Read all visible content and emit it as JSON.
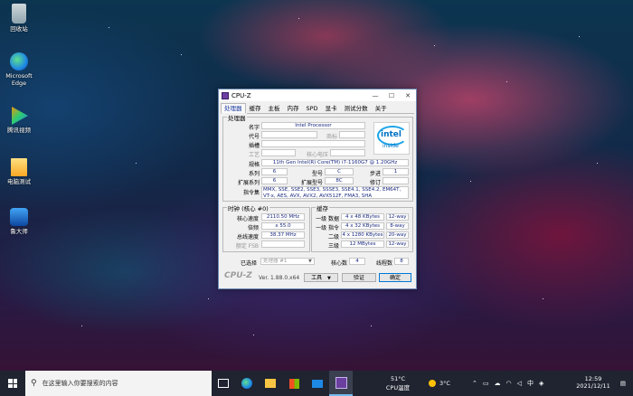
{
  "desktop": {
    "icons": [
      {
        "label": "回收站",
        "icon": "recycle-bin-icon"
      },
      {
        "label": "Microsoft Edge",
        "icon": "edge-icon"
      },
      {
        "label": "腾讯视频",
        "icon": "tencent-video-icon"
      },
      {
        "label": "电脑测试",
        "icon": "folder-icon"
      },
      {
        "label": "鲁大师",
        "icon": "ludashi-icon"
      }
    ]
  },
  "window": {
    "title": "CPU-Z",
    "tabs": [
      "处理器",
      "缓存",
      "主板",
      "内存",
      "SPD",
      "显卡",
      "测试分数",
      "关于"
    ],
    "processor": {
      "group_label": "处理器",
      "name_label": "名字",
      "name": "Intel Processor",
      "codename_label": "代号",
      "brand_label": "商标",
      "package_label": "插槽",
      "tech_label": "工艺",
      "voltage_label": "核心电压",
      "spec_label": "规格",
      "spec": "11th Gen Intel(R) Core(TM) i7-1160G7 @ 1.20GHz",
      "family_label": "系列",
      "family": "6",
      "model_label": "型号",
      "model": "C",
      "stepping_label": "步进",
      "stepping": "1",
      "extfamily_label": "扩展系列",
      "extfamily": "6",
      "extmodel_label": "扩展型号",
      "extmodel": "8C",
      "revision_label": "修订",
      "instructions_label": "指令集",
      "instructions": "MMX, SSE, SSE2, SSE3, SSSE3, SSE4.1, SSE4.2, EM64T, VT-x, AES, AVX, AVX2, AVX512F, FMA3, SHA",
      "logo_brand": "intel",
      "logo_sub": "inside"
    },
    "clocks": {
      "group_label": "时钟 (核心 #0)",
      "core_speed_label": "核心速度",
      "core_speed": "2110.50 MHz",
      "multiplier_label": "倍频",
      "multiplier": "x 55.0",
      "bus_speed_label": "总线速度",
      "bus_speed": "38.37 MHz",
      "fsb_label": "额定 FSB"
    },
    "cache": {
      "group_label": "缓存",
      "rows": [
        {
          "label": "一级 数据",
          "size": "4 x 48 KBytes",
          "way": "12-way"
        },
        {
          "label": "一级 指令",
          "size": "4 x 32 KBytes",
          "way": "8-way"
        },
        {
          "label": "二级",
          "size": "4 x 1280 KBytes",
          "way": "20-way"
        },
        {
          "label": "三级",
          "size": "12 MBytes",
          "way": "12-way"
        }
      ]
    },
    "selection": {
      "label": "已选择",
      "value": "处理器 #1",
      "cores_label": "核心数",
      "cores": "4",
      "threads_label": "线程数",
      "threads": "8"
    },
    "footer": {
      "brand": "CPU-Z",
      "version": "Ver. 1.88.0.x64",
      "tools": "工具",
      "validate": "验证",
      "ok": "确定"
    }
  },
  "taskbar": {
    "search_placeholder": "在这里输入你要搜索的内容",
    "cpu_temp": "51°C",
    "cpu_temp_label": "CPU温度",
    "weather": "3°C",
    "time": "12:59",
    "date": "2021/12/11",
    "colors": {
      "accent": "#1f2430"
    }
  }
}
